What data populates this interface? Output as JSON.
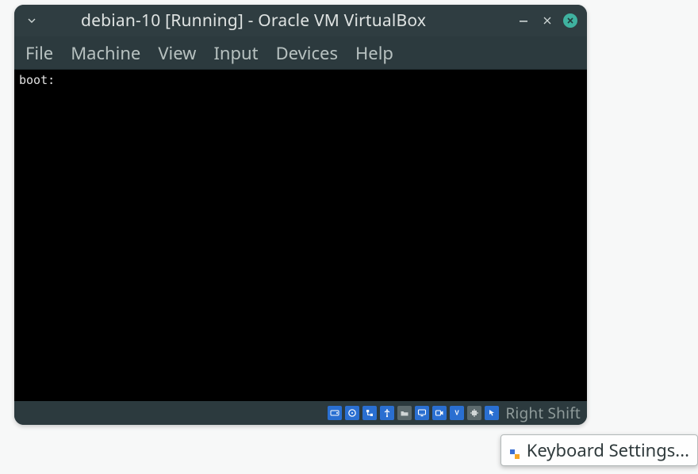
{
  "window": {
    "title": "debian-10 [Running] - Oracle VM VirtualBox"
  },
  "menubar": {
    "items": [
      {
        "label": "File"
      },
      {
        "label": "Machine"
      },
      {
        "label": "View"
      },
      {
        "label": "Input"
      },
      {
        "label": "Devices"
      },
      {
        "label": "Help"
      }
    ]
  },
  "console": {
    "line0": "boot:"
  },
  "statusbar": {
    "host_key": "Right Shift",
    "icons": [
      "hard-disk-icon",
      "optical-disc-icon",
      "network-icon",
      "usb-icon",
      "shared-folders-icon",
      "display-icon",
      "recording-icon",
      "video-capture-icon",
      "cpu-icon",
      "mouse-integration-icon"
    ]
  },
  "tooltip": {
    "label": "Keyboard Settings..."
  }
}
